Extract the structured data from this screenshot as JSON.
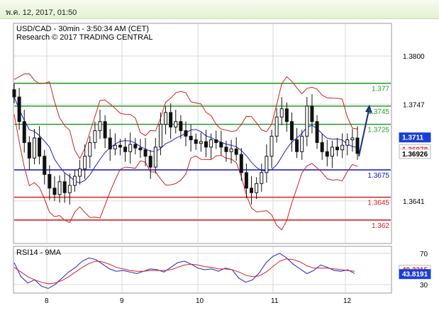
{
  "window": {
    "date_label": "พ.ค. 12, 2017, 01:50"
  },
  "colors": {
    "support_blue": "#1010c0",
    "resistance_green": "#2b9a2b",
    "red_line": "#d42020",
    "bollinger": "#d02020",
    "ma_blue": "#2020c8",
    "candle": "#111111",
    "grid": "#d9d9d9"
  },
  "chart_data": [
    {
      "type": "candlestick",
      "header": [
        "USD/CAD - 30min - 3:50:34 AM (CET)",
        "Research © 2017 TRADING CENTRAL"
      ],
      "y_axis": {
        "ticks": [
          1.38,
          1.3747,
          1.3641
        ],
        "tick_labels": [
          "1.3800",
          "1.3747",
          "1.3641"
        ],
        "ylim": [
          1.3595,
          1.3835
        ]
      },
      "x_axis": {
        "tick_labels": [
          "8",
          "9",
          "10",
          "11",
          "12"
        ]
      },
      "grid": true,
      "levels": [
        {
          "value": 1.377,
          "label": "1.377",
          "role": "resistance"
        },
        {
          "value": 1.3745,
          "label": "1.3745",
          "role": "resistance"
        },
        {
          "value": 1.3725,
          "label": "1.3725",
          "role": "resistance"
        },
        {
          "value": 1.3675,
          "label": "1.3675",
          "role": "support"
        },
        {
          "value": 1.3645,
          "label": "1.3645",
          "role": "support"
        },
        {
          "value": 1.362,
          "label": "1.362",
          "role": "support"
        }
      ],
      "price_tags": [
        {
          "value": 1.3711,
          "label": "1.3711",
          "bg": "#1a3fd6",
          "fg": "#ffffff"
        },
        {
          "value": 1.3698,
          "label": "1.36978",
          "bg": "#ffffff",
          "fg": "#d42020"
        },
        {
          "value": 1.3693,
          "label": "1.36926",
          "bg": "#ffffff",
          "fg": "#000000"
        }
      ],
      "close_series": [
        1.3755,
        1.3728,
        1.3705,
        1.3688,
        1.371,
        1.369,
        1.367,
        1.3655,
        1.3648,
        1.3662,
        1.365,
        1.3658,
        1.3668,
        1.3676,
        1.369,
        1.3705,
        1.3718,
        1.3728,
        1.371,
        1.3698,
        1.3702,
        1.37,
        1.3695,
        1.3703,
        1.3699,
        1.3697,
        1.369,
        1.3678,
        1.37,
        1.3725,
        1.3738,
        1.3722,
        1.3728,
        1.3718,
        1.3712,
        1.3708,
        1.3704,
        1.3706,
        1.37,
        1.3708,
        1.3705,
        1.37,
        1.3695,
        1.3698,
        1.3692,
        1.3672,
        1.3655,
        1.365,
        1.366,
        1.3672,
        1.369,
        1.3712,
        1.3733,
        1.3742,
        1.3728,
        1.3708,
        1.3695,
        1.3712,
        1.3745,
        1.3728,
        1.3705,
        1.3695,
        1.369,
        1.37,
        1.3697,
        1.3702,
        1.3708,
        1.371,
        1.3693
      ],
      "projection": {
        "from": 1.369,
        "to": 1.3745,
        "label": "bullish-target-arrow"
      }
    },
    {
      "type": "line",
      "header": "RSI14 - 9MA",
      "y_axis": {
        "ticks": [
          70,
          30
        ],
        "tick_labels": [
          "70",
          "30"
        ],
        "ylim": [
          20,
          78
        ]
      },
      "series": [
        {
          "name": "RSI14",
          "values": [
            58,
            40,
            32,
            36,
            28,
            25,
            30,
            38,
            46,
            52,
            60,
            64,
            62,
            56,
            50,
            47,
            48,
            46,
            44,
            47,
            50,
            49,
            46,
            52,
            58,
            60,
            56,
            51,
            49,
            50,
            47,
            51,
            49,
            38,
            33,
            36,
            45,
            58,
            66,
            70,
            64,
            56,
            50,
            44,
            48,
            55,
            52,
            48,
            47,
            49,
            44
          ]
        },
        {
          "name": "9MA",
          "values": [
            52,
            46,
            40,
            36,
            33,
            31,
            32,
            35,
            40,
            46,
            52,
            57,
            60,
            59,
            56,
            52,
            50,
            48,
            47,
            47,
            48,
            48,
            48,
            49,
            52,
            55,
            56,
            55,
            53,
            52,
            50,
            50,
            49,
            46,
            42,
            40,
            41,
            46,
            53,
            60,
            63,
            62,
            59,
            54,
            51,
            51,
            51,
            50,
            49,
            48,
            47
          ]
        }
      ],
      "value_tags": [
        {
          "value": 49.3315,
          "label": "49.3315",
          "bg": "#ffffff",
          "fg": "#d42020"
        },
        {
          "value": 43.8191,
          "label": "43.8191",
          "bg": "#1a3fd6",
          "fg": "#ffffff"
        }
      ]
    }
  ]
}
